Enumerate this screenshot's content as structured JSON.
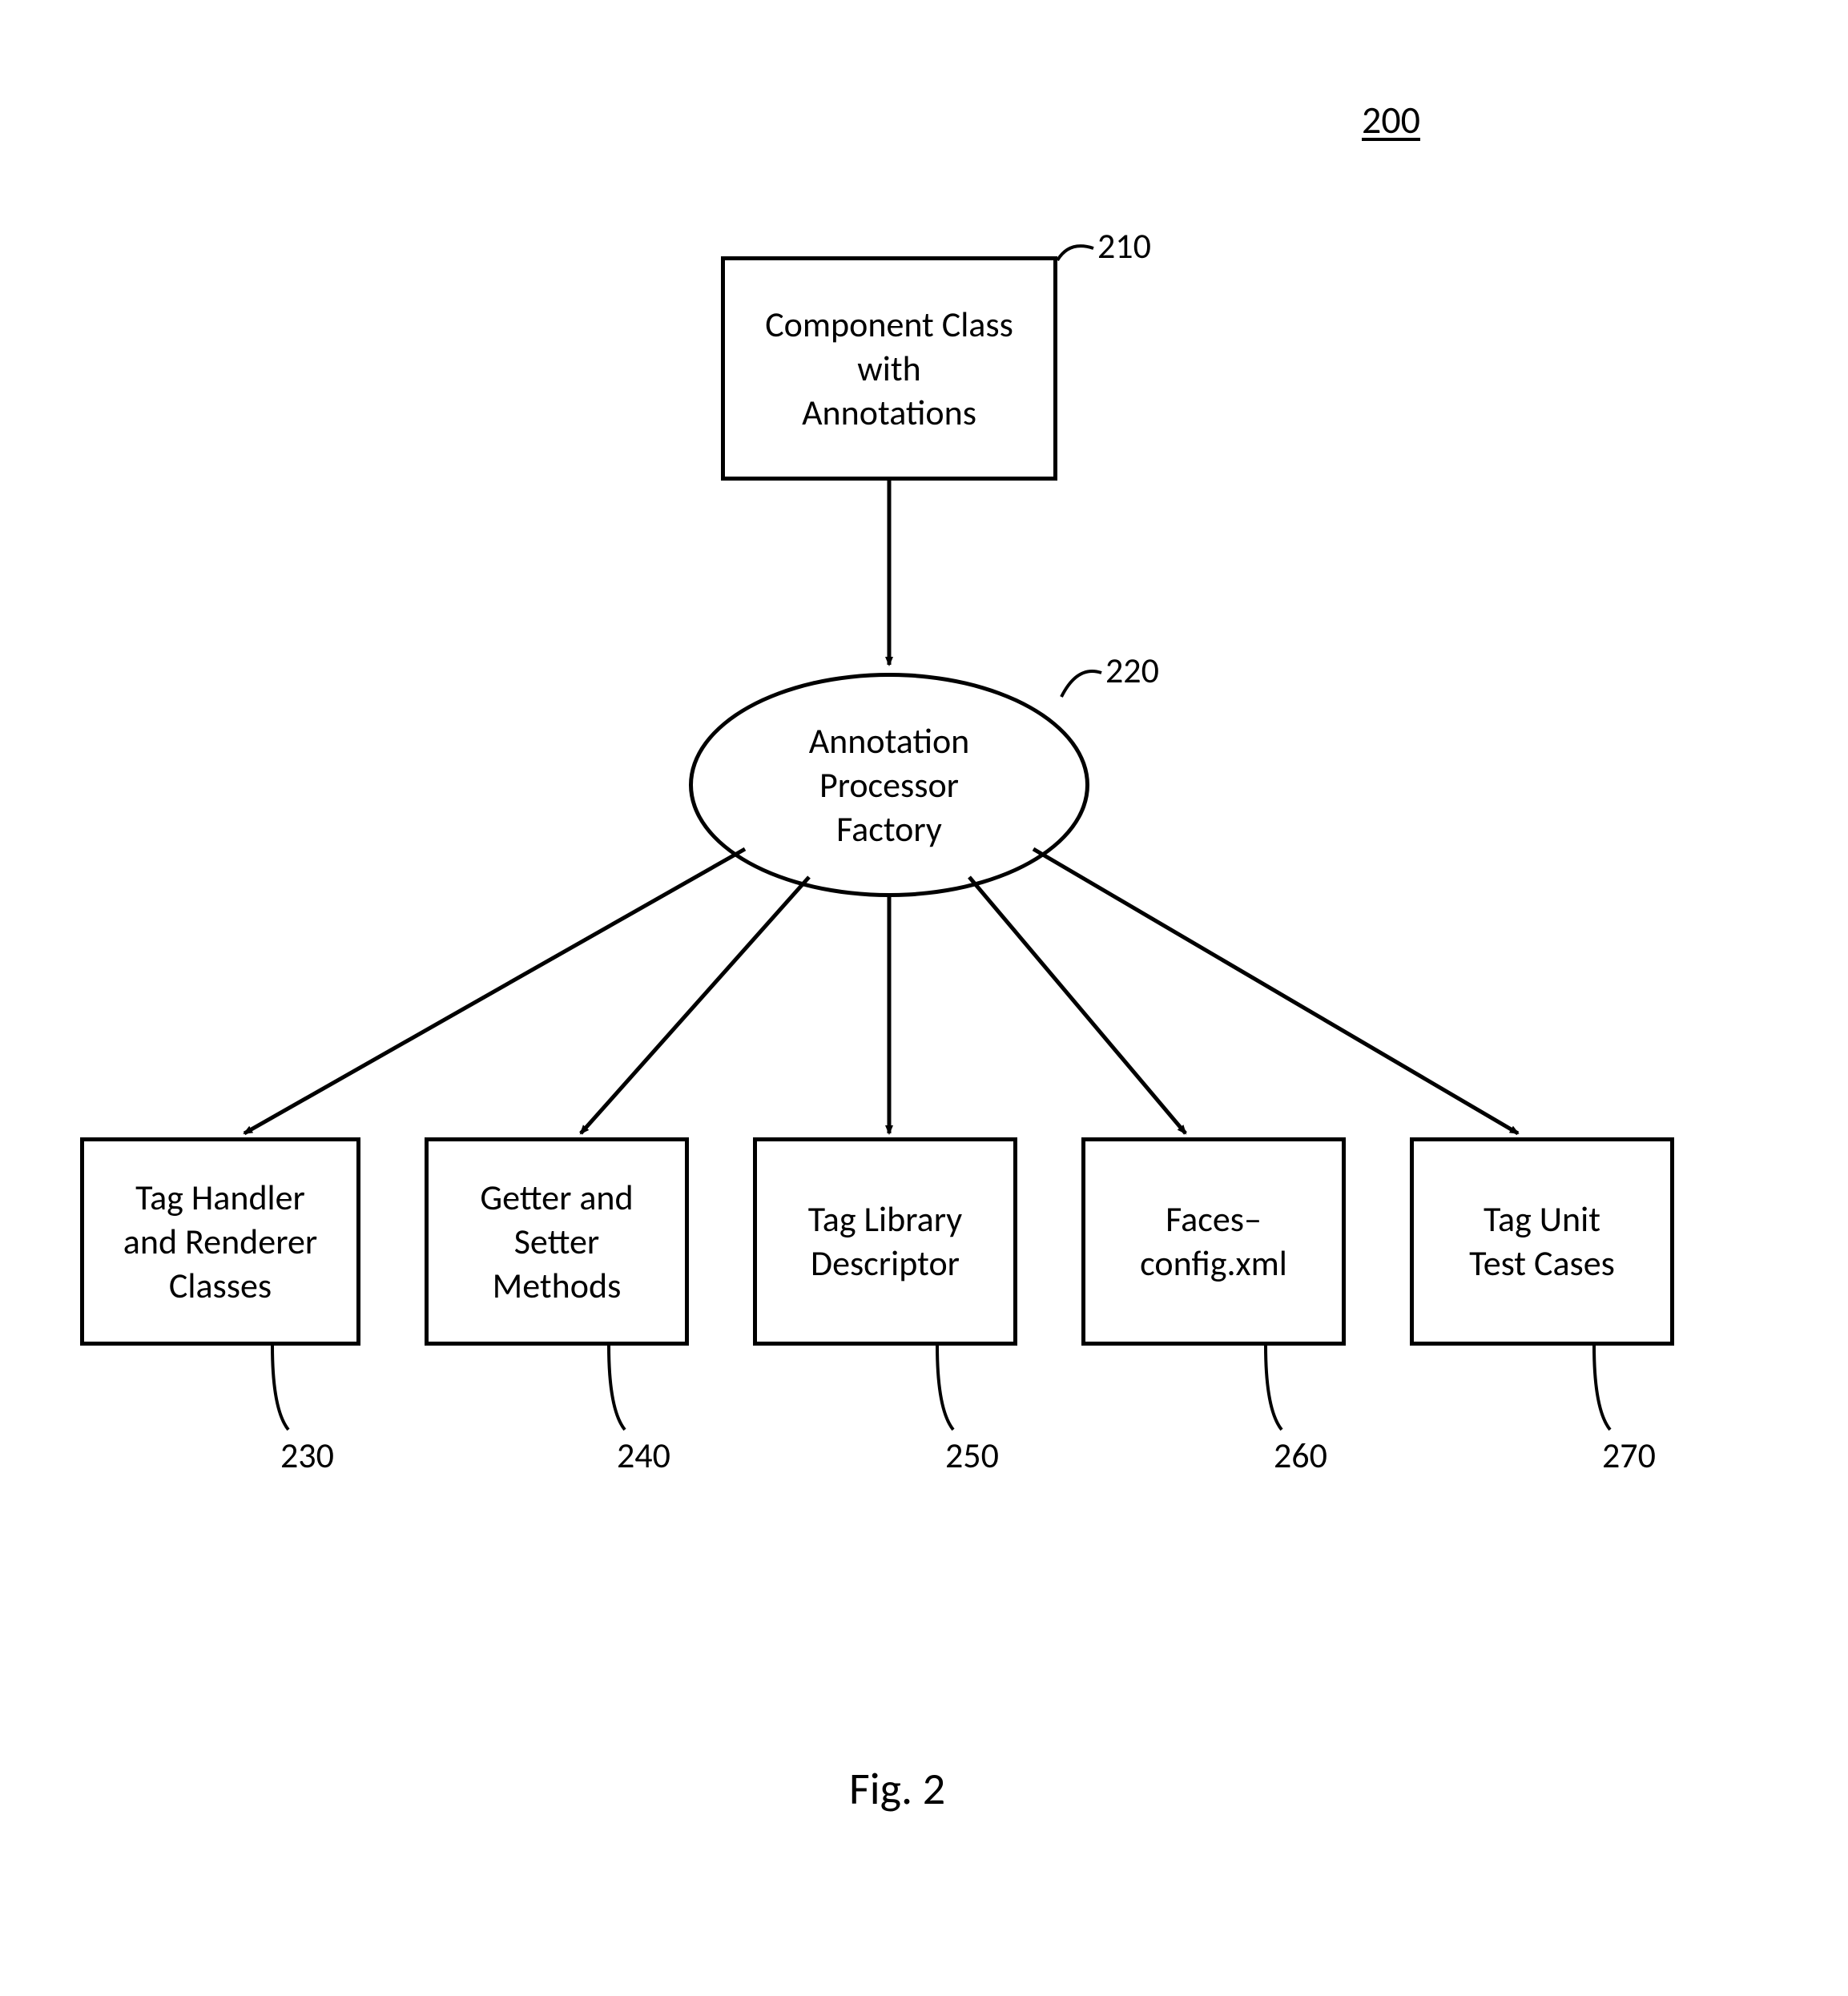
{
  "figure": {
    "number": "200",
    "caption": "Fig. 2"
  },
  "nodes": {
    "component": {
      "label": "Component Class\nwith\nAnnotations",
      "ref": "210"
    },
    "factory": {
      "label": "Annotation\nProcessor\nFactory",
      "ref": "220"
    },
    "out1": {
      "label": "Tag Handler\nand Renderer\nClasses",
      "ref": "230"
    },
    "out2": {
      "label": "Getter and\nSetter\nMethods",
      "ref": "240"
    },
    "out3": {
      "label": "Tag Library\nDescriptor",
      "ref": "250"
    },
    "out4": {
      "label": "Faces–\nconfig.xml",
      "ref": "260"
    },
    "out5": {
      "label": "Tag Unit\nTest Cases",
      "ref": "270"
    }
  }
}
